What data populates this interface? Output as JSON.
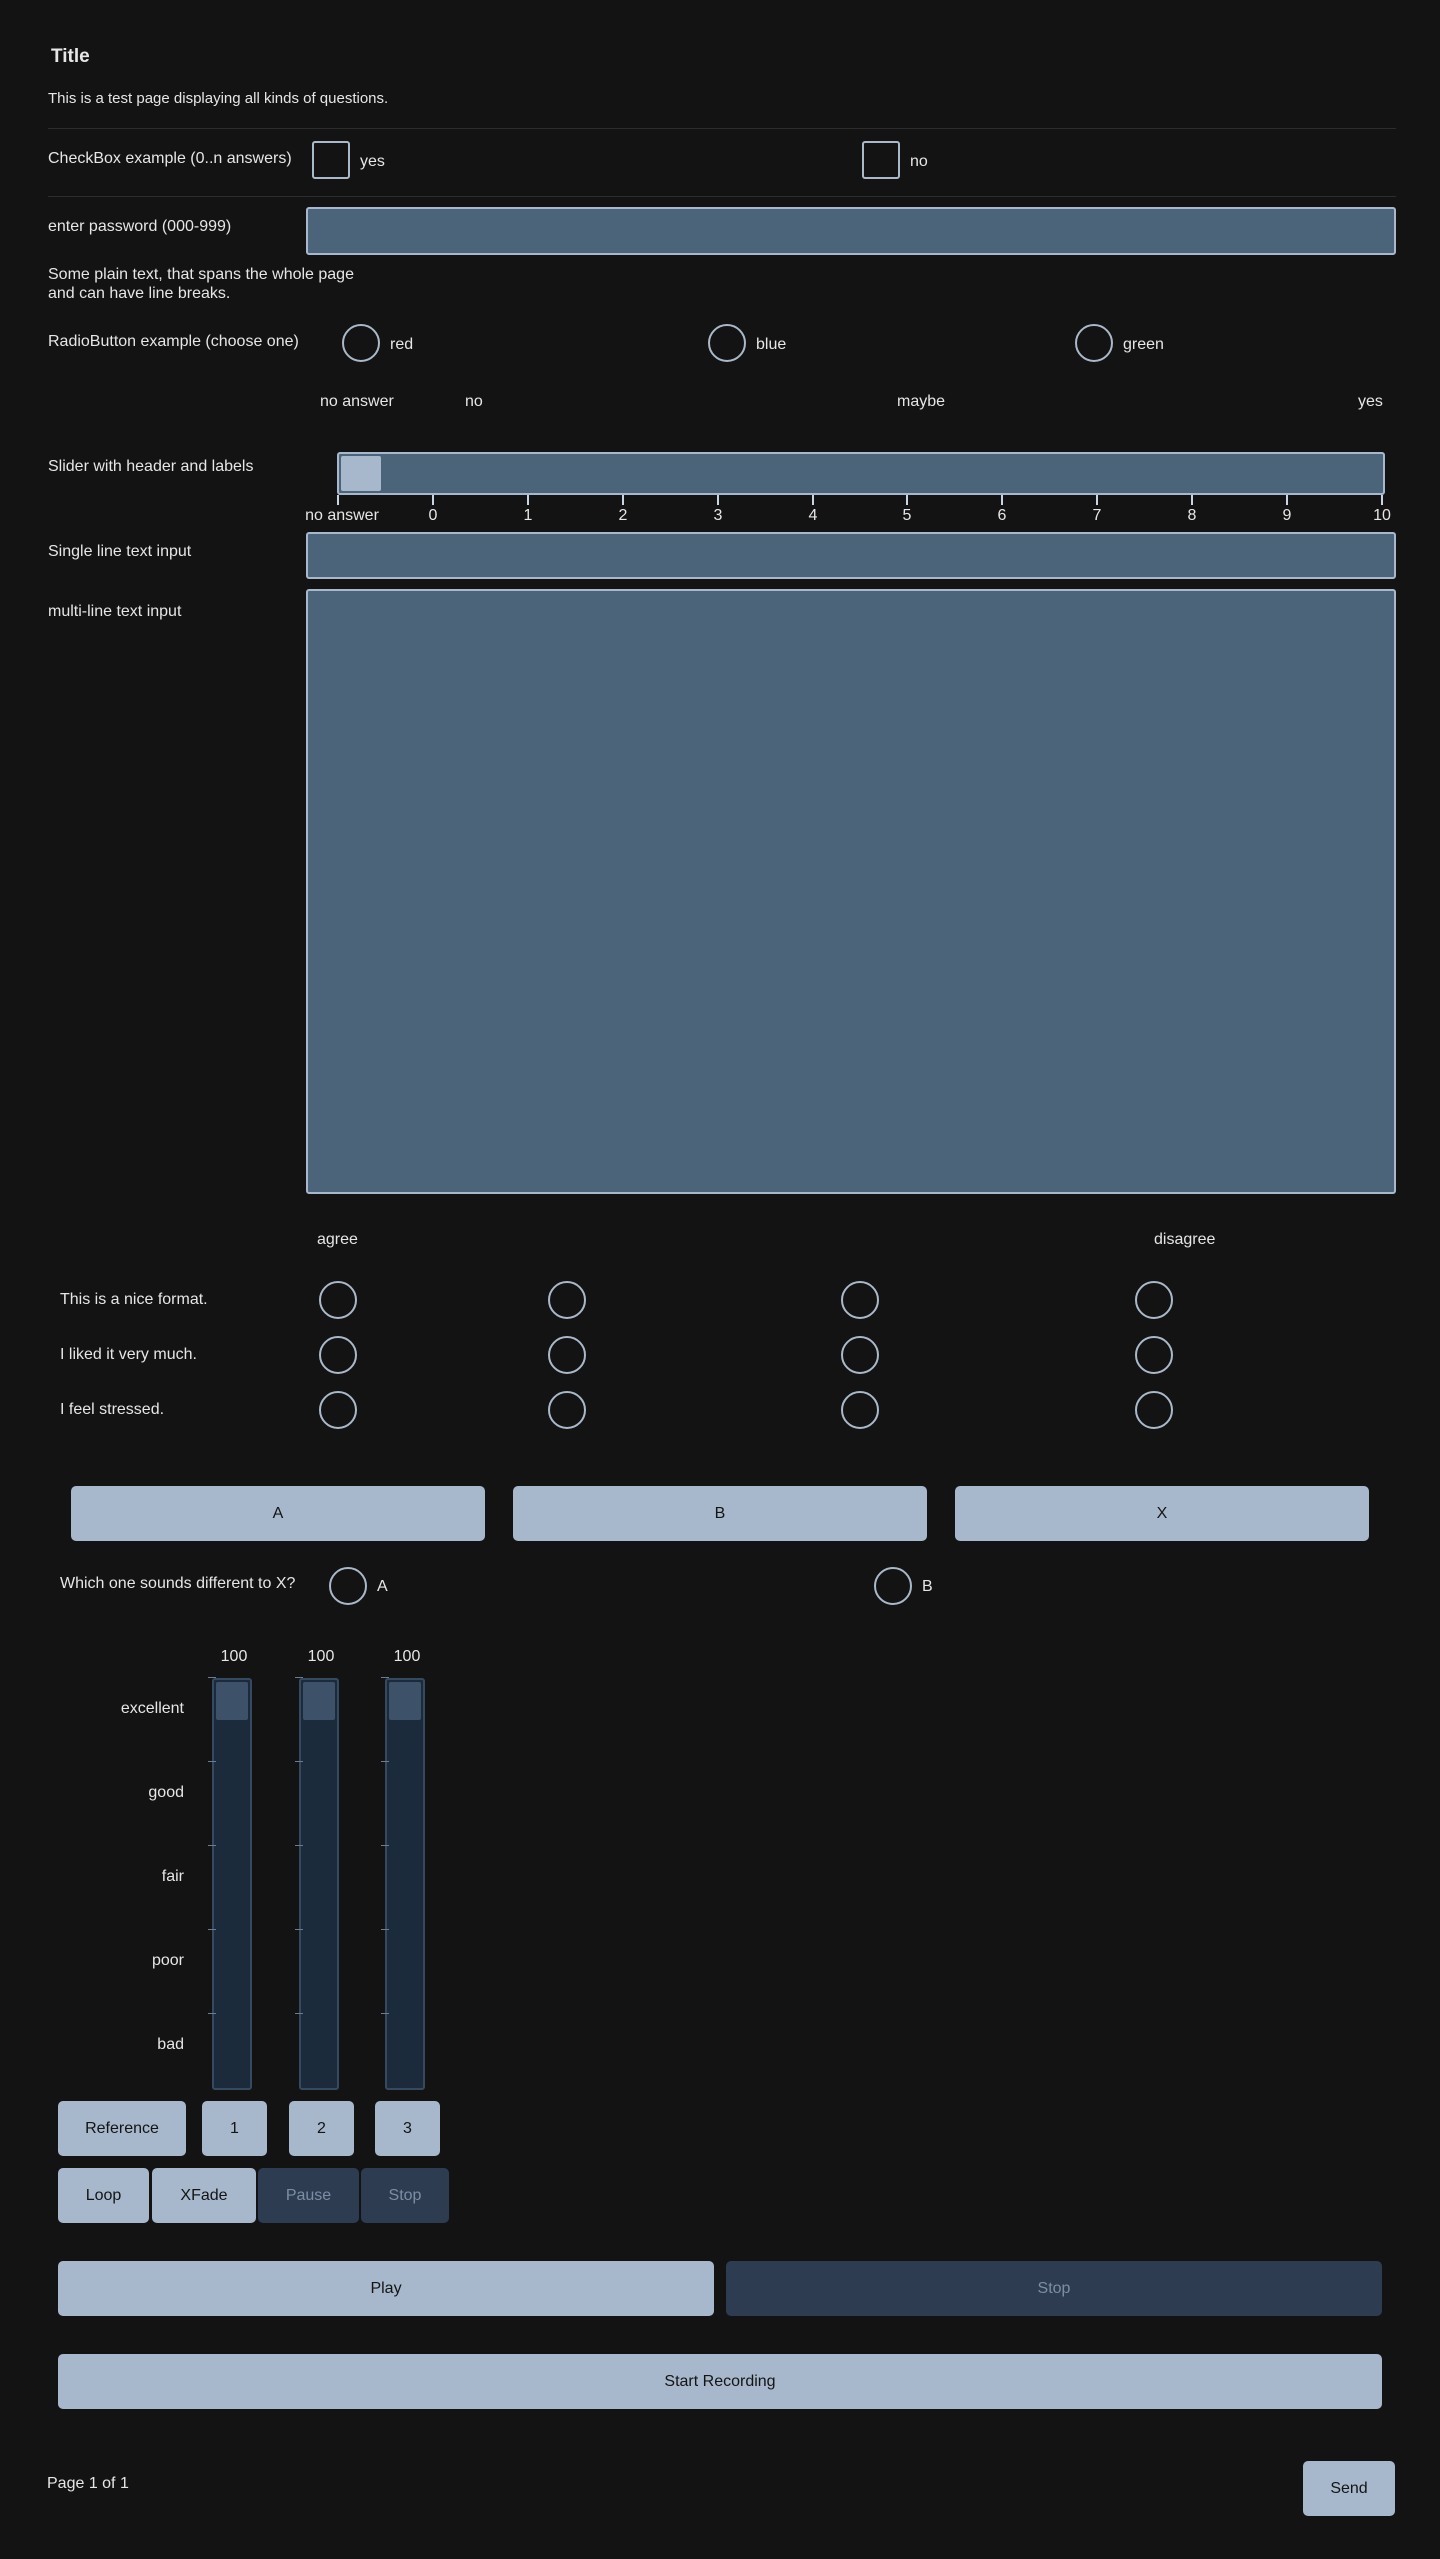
{
  "page": {
    "title": "Title",
    "description": "This is a test page displaying all kinds of questions.",
    "footer": "Page 1 of 1",
    "send_label": "Send"
  },
  "checkbox_q": {
    "label": "CheckBox example (0..n answers)",
    "options": [
      "yes",
      "no"
    ]
  },
  "password_q": {
    "label": "enter password (000-999)",
    "value": ""
  },
  "plain_text": {
    "line1": "Some plain text, that spans the whole page",
    "line2": "and can have line breaks."
  },
  "radio_q": {
    "label": "RadioButton example (choose one)",
    "options": [
      "red",
      "blue",
      "green"
    ]
  },
  "slider_q": {
    "label": "Slider with header and labels",
    "header_labels": [
      "no answer",
      "no",
      "maybe",
      "yes"
    ],
    "ticks": [
      "no answer",
      "0",
      "1",
      "2",
      "3",
      "4",
      "5",
      "6",
      "7",
      "8",
      "9",
      "10"
    ],
    "value": "no answer"
  },
  "text_q": {
    "label": "Single line text input",
    "value": ""
  },
  "multiline_q": {
    "label": "multi-line text input",
    "value": ""
  },
  "likert": {
    "header_left": "agree",
    "header_right": "disagree",
    "rows": [
      "This is a nice format.",
      "I liked it very much.",
      "I feel stressed."
    ]
  },
  "abx": {
    "buttons": [
      "A",
      "B",
      "X"
    ],
    "question": "Which one sounds different to X?",
    "options": [
      "A",
      "B"
    ]
  },
  "mushra": {
    "values": [
      "100",
      "100",
      "100"
    ],
    "levels": [
      1.0,
      1.0,
      1.0
    ],
    "scale": [
      "excellent",
      "good",
      "fair",
      "poor",
      "bad"
    ],
    "buttons": {
      "reference": "Reference",
      "c1": "1",
      "c2": "2",
      "c3": "3"
    },
    "controls": {
      "loop": "Loop",
      "xfade": "XFade",
      "pause": "Pause",
      "stop": "Stop"
    }
  },
  "player": {
    "play": "Play",
    "stop": "Stop",
    "record": "Start Recording"
  },
  "colors": {
    "background": "#131313",
    "field": "#4b647a",
    "button": "#a7b8cc",
    "button_disabled": "#2d3c51"
  }
}
